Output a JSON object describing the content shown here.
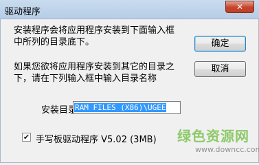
{
  "window": {
    "title": "驱动程序",
    "close_glyph": "✕"
  },
  "message": {
    "line1": "安装程序会将应用程序安装到下面输入框",
    "line2": "中所列的目录底下。",
    "line3": "如果您欲将应用程序安装到其它的目录之",
    "line4": "下，请在下列输入框中输入目录名称"
  },
  "buttons": {
    "ok_label": "确定",
    "cancel_label": "取消"
  },
  "install_dir": {
    "label": "安装目录:",
    "value": "RAM FILES (X86)\\UGEE"
  },
  "component": {
    "checked": true,
    "check_glyph": "✔",
    "label": "手写板驱动程序 V5.02 (3MB)"
  },
  "watermark": {
    "logo": "绿色资源网",
    "url": "www.downcc.com"
  }
}
